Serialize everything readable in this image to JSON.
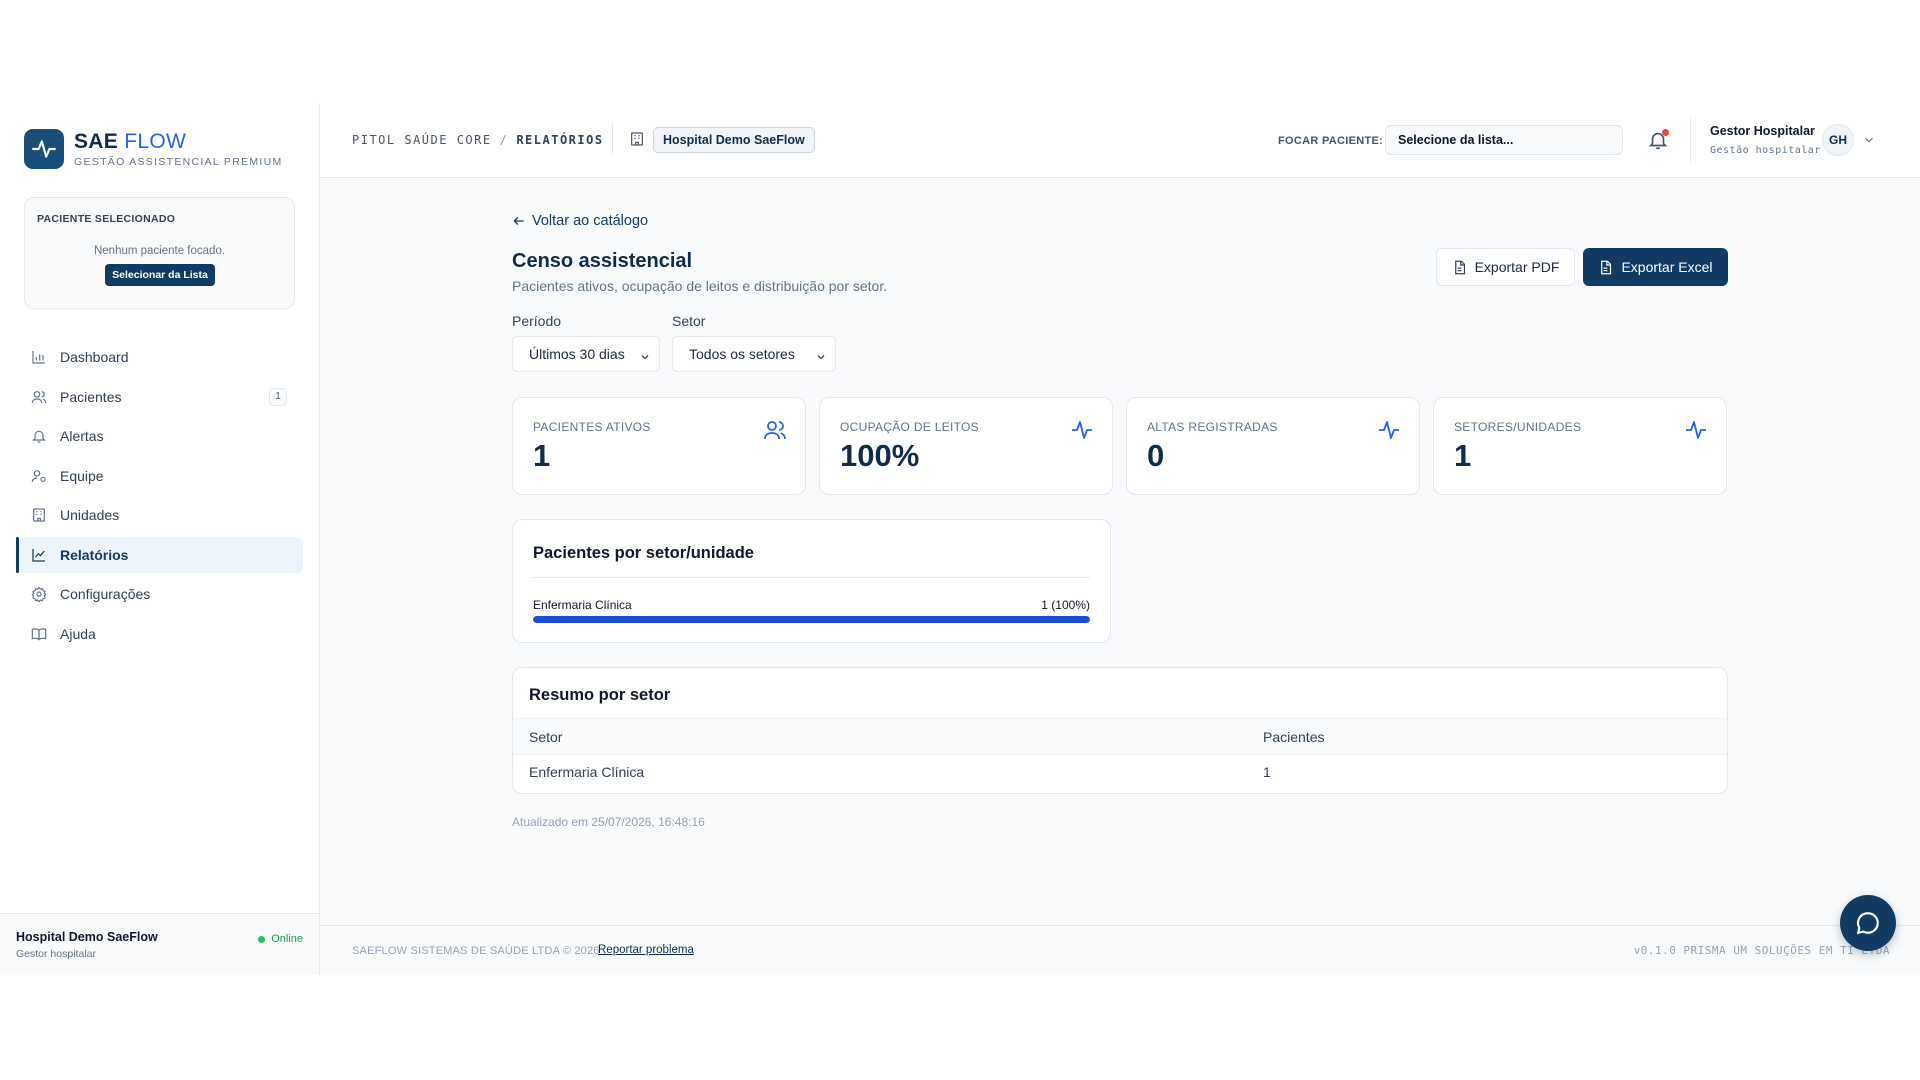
{
  "brand": {
    "name_part1": "SAE",
    "name_part2": "FLOW",
    "tagline": "GESTÃO ASSISTENCIAL PREMIUM"
  },
  "patient_card": {
    "title": "PACIENTE SELECIONADO",
    "empty_text": "Nenhum paciente focado.",
    "button": "Selecionar da Lista"
  },
  "nav": {
    "items": [
      {
        "label": "Dashboard",
        "icon": "bar-chart-icon"
      },
      {
        "label": "Pacientes",
        "icon": "users-icon",
        "badge": "1"
      },
      {
        "label": "Alertas",
        "icon": "bell-icon"
      },
      {
        "label": "Equipe",
        "icon": "team-icon"
      },
      {
        "label": "Unidades",
        "icon": "building-icon"
      },
      {
        "label": "Relatórios",
        "icon": "line-chart-icon",
        "active": true
      },
      {
        "label": "Configurações",
        "icon": "gear-icon"
      },
      {
        "label": "Ajuda",
        "icon": "book-icon"
      }
    ]
  },
  "sidebar_footer": {
    "hospital": "Hospital Demo SaeFlow",
    "role": "Gestor hospitalar",
    "status": "Online"
  },
  "header": {
    "breadcrumb": [
      "PITOL SAÚDE CORE",
      "RELATÓRIOS"
    ],
    "breadcrumb_sep": "/",
    "hospital_pill": "Hospital Demo SaeFlow",
    "focus_label": "FOCAR PACIENTE:",
    "focus_placeholder": "Selecione da lista...",
    "user_name": "Gestor Hospitalar",
    "user_role": "Gestão hospitalar",
    "avatar_initials": "GH"
  },
  "main": {
    "back_label": "Voltar ao catálogo",
    "title": "Censo assistencial",
    "subtitle": "Pacientes ativos, ocupação de leitos e distribuição por setor.",
    "export_pdf": "Exportar PDF",
    "export_excel": "Exportar Excel",
    "filters": {
      "period_label": "Período",
      "period_value": "Últimos 30 dias",
      "sector_label": "Setor",
      "sector_value": "Todos os setores"
    },
    "kpis": [
      {
        "label": "PACIENTES ATIVOS",
        "value": "1",
        "icon": "users-icon"
      },
      {
        "label": "OCUPAÇÃO DE LEITOS",
        "value": "100%",
        "icon": "activity-icon"
      },
      {
        "label": "ALTAS REGISTRADAS",
        "value": "0",
        "icon": "activity-icon"
      },
      {
        "label": "SETORES/UNIDADES",
        "value": "1",
        "icon": "activity-icon"
      }
    ],
    "distribution": {
      "title": "Pacientes por setor/unidade",
      "rows": [
        {
          "label": "Enfermaria Clínica",
          "value_text": "1 (100%)",
          "fraction": 1.0
        }
      ]
    },
    "summary": {
      "title": "Resumo por setor",
      "columns": [
        "Setor",
        "Pacientes"
      ],
      "rows": [
        [
          "Enfermaria Clínica",
          "1"
        ]
      ]
    },
    "updated": "Atualizado em 25/07/2026, 16:48:16"
  },
  "footer": {
    "copyright": "SAEFLOW SISTEMAS DE SAÚDE LTDA © 2026",
    "report_link": "Reportar problema",
    "version_info": "v0.1.0   PRISMA UM SOLUÇÕES EM TI LTDA"
  },
  "colors": {
    "primary": "#123b63",
    "accent": "#2563eb",
    "bar": "#1d4ed8",
    "online": "#22c55e",
    "notify": "#ef4444"
  }
}
